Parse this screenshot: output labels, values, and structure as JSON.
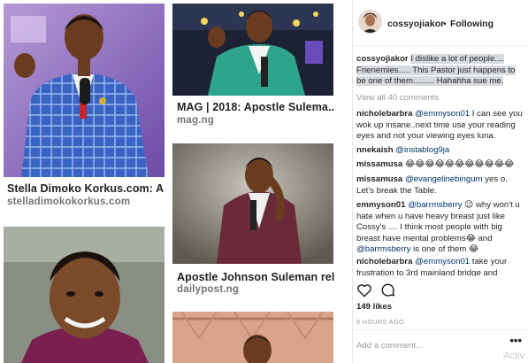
{
  "results": [
    {
      "title": "Stella Dimoko Korkus.com: A...",
      "source": "stelladimokokorkus.com"
    },
    {
      "title": "MAG | 2018: Apostle Sulema...",
      "source": "mag.ng"
    },
    {
      "title": "Apostle Johnson Suleman rel...",
      "source": "dailypost.ng"
    }
  ],
  "post": {
    "username": "cossyojiakor",
    "separator": "•",
    "following_label": "Following",
    "caption": "I dislike a lot of people.... Frienemies..... This Pastor just happens to be one of them......... Hahahha sue me.",
    "view_all": "View all 40 comments",
    "comments": [
      {
        "user": "nicholebarbra",
        "mention": "@emmyson01",
        "text": " I can see you wok up insane..next time use your reading eyes and not your viewing eyes luna."
      },
      {
        "user": "nnekaish",
        "mention": "@instablog9ja",
        "text": ""
      },
      {
        "user": "missamusa",
        "mention": "",
        "text": "😂😂😂😂😂😂😂😂😂😂😂"
      },
      {
        "user": "missamusa",
        "mention": "@evangelinebingum",
        "text": " yes o. Let's break the Table."
      },
      {
        "user": "emmyson01",
        "mention": "@barrmsberry",
        "text": " 😉 why won't u hate when u have heavy breast just like Cossy's .... I think most people with big breast have mental problems😂 and ",
        "mention2": "@barrmsberry",
        "text2": " is one of them 😂"
      },
      {
        "user": "nicholebarbra",
        "mention": "@emmyson01",
        "text": " take your frustration to 3rd mainland bridge and"
      }
    ],
    "likes": "149 likes",
    "time": "8 HOURS AGO",
    "add_comment_placeholder": "Add a comment...",
    "more_glyph": "•••"
  },
  "watermark": "Activ",
  "icons": {
    "like": "heart-icon",
    "comment": "comment-bubble-icon"
  },
  "colors": {
    "caption_highlight": "#d7dadf",
    "mention": "#003569",
    "muted": "#999999"
  }
}
